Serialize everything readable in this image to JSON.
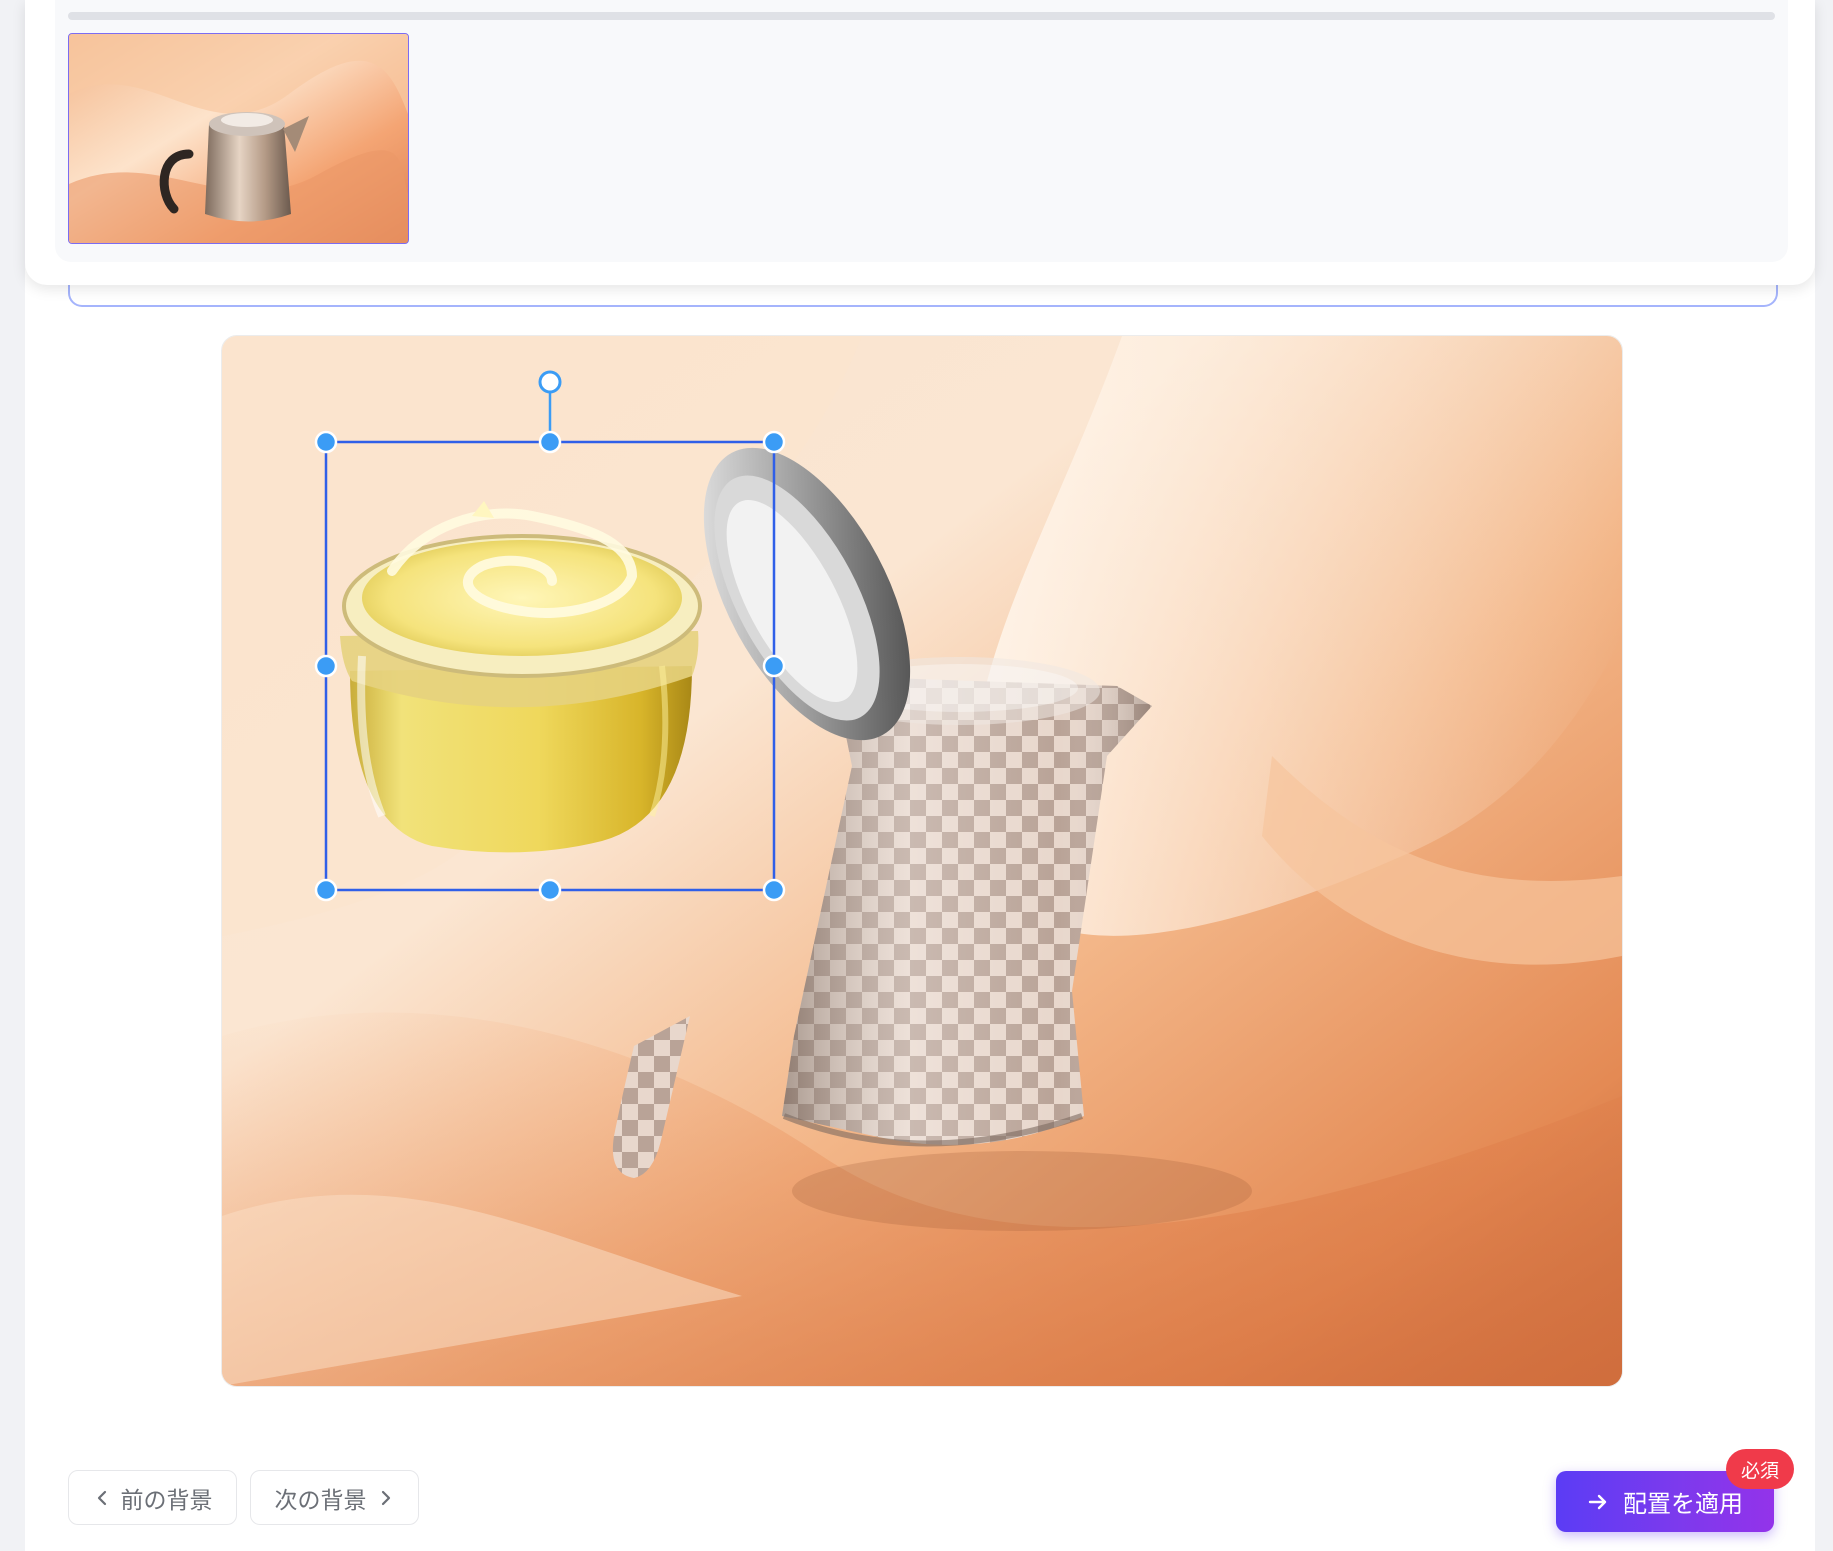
{
  "navigation": {
    "prev_label": "前の背景",
    "next_label": "次の背景"
  },
  "actions": {
    "apply_label": "配置を適用",
    "required_badge": "必須"
  },
  "colors": {
    "accent_start": "#5b3cf5",
    "accent_end": "#9333ea",
    "badge": "#f03a4a",
    "selection": "#2f5fe8",
    "handle": "#3b9cf5"
  },
  "icons": {
    "prev": "chevron-left-icon",
    "next": "chevron-right-icon",
    "apply": "arrow-right-icon"
  }
}
